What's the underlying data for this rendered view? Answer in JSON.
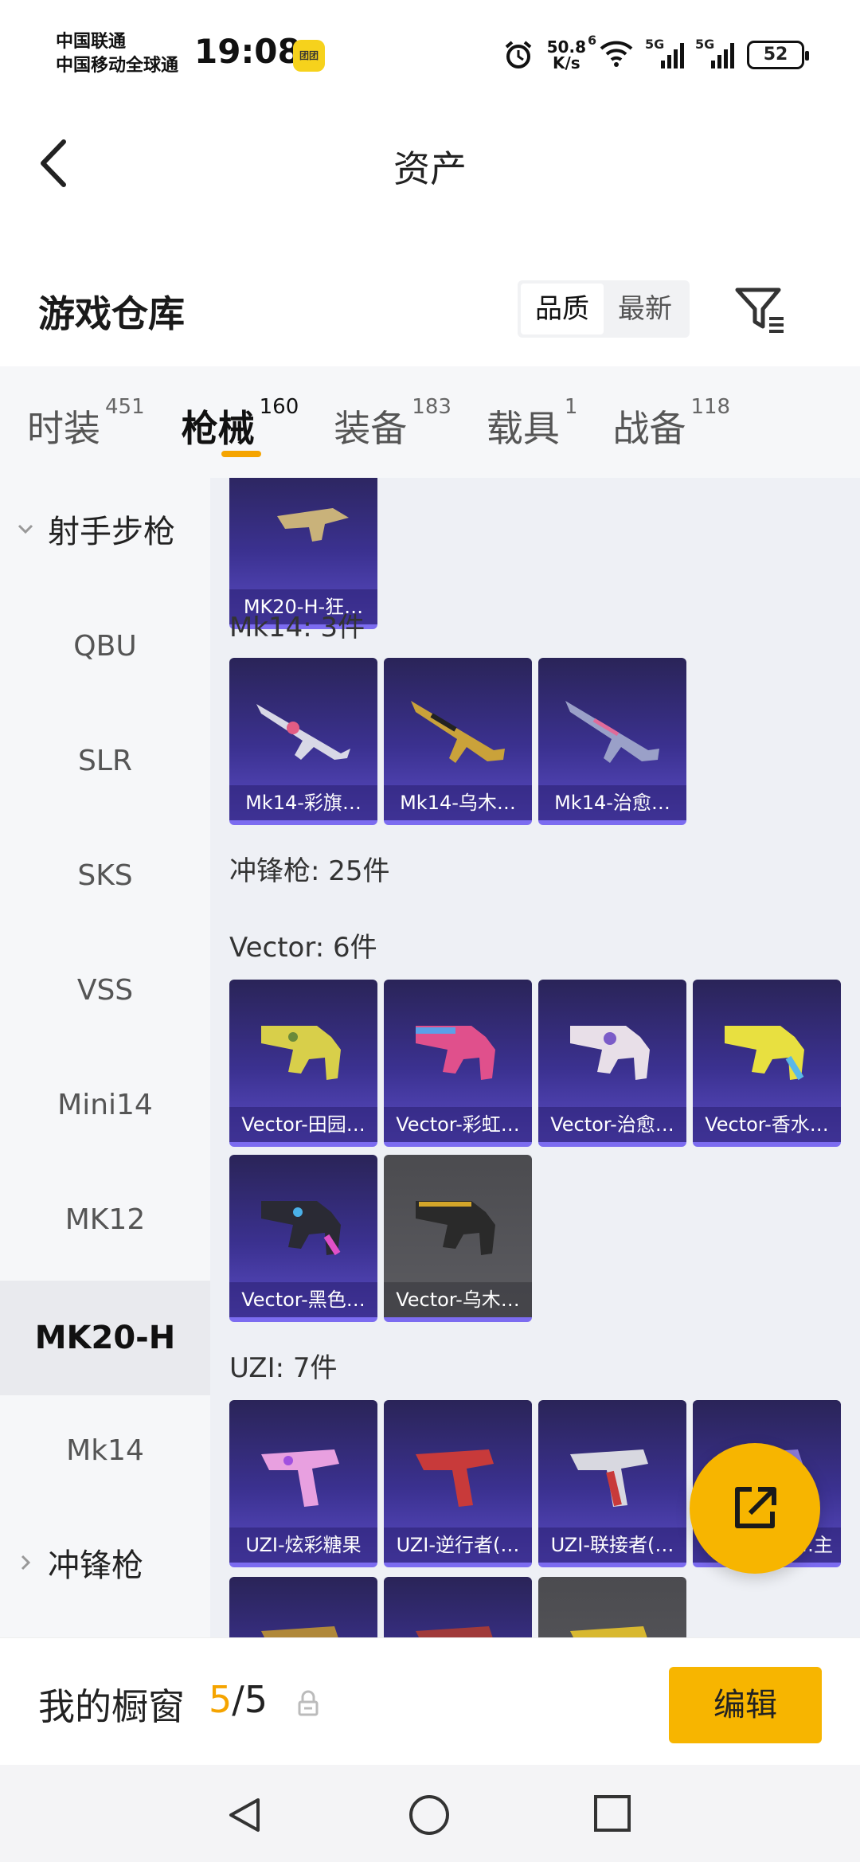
{
  "status_bar": {
    "carrier1": "中国联通",
    "carrier2": "中国移动全球通",
    "time": "19:08",
    "app_badge": "团团",
    "net_speed_value": "50.8",
    "net_speed_unit": "K/s",
    "wifi_label": "6",
    "signal1_label": "5G",
    "signal2_label": "5G",
    "battery": "52"
  },
  "header": {
    "title": "资产"
  },
  "warehouse": {
    "title": "游戏仓库",
    "sort_quality": "品质",
    "sort_latest": "最新"
  },
  "tabs": [
    {
      "label": "时装",
      "count": "451"
    },
    {
      "label": "枪械",
      "count": "160"
    },
    {
      "label": "装备",
      "count": "183"
    },
    {
      "label": "载具",
      "count": "1"
    },
    {
      "label": "战备",
      "count": "118"
    }
  ],
  "sidebar": {
    "items": [
      {
        "label": "射手步枪"
      },
      {
        "label": "QBU"
      },
      {
        "label": "SLR"
      },
      {
        "label": "SKS"
      },
      {
        "label": "VSS"
      },
      {
        "label": "Mini14"
      },
      {
        "label": "MK12"
      },
      {
        "label": "MK20-H"
      },
      {
        "label": "Mk14"
      },
      {
        "label": "冲锋枪"
      }
    ]
  },
  "content": {
    "top_card": "MK20-H-狂…",
    "mk14_header": "Mk14: 3件",
    "mk14_cards": [
      "Mk14-彩旗…",
      "Mk14-乌木…",
      "Mk14-治愈…"
    ],
    "smg_header": "冲锋枪: 25件",
    "vector_header": "Vector: 6件",
    "vector_cards": [
      "Vector-田园…",
      "Vector-彩虹…",
      "Vector-治愈…",
      "Vector-香水…",
      "Vector-黑色…",
      "Vector-乌木…"
    ],
    "uzi_header": "UZI: 7件",
    "uzi_cards": [
      "UZI-炫彩糖果",
      "UZI-逆行者(…",
      "UZI-联接者(…",
      "…主"
    ]
  },
  "bottom": {
    "window_label": "我的橱窗",
    "used": "5",
    "total": "/5",
    "edit_label": "编辑"
  },
  "colors": {
    "accent": "#f7b500",
    "card": "#3b3190",
    "selected_bg": "#e9eaee"
  }
}
